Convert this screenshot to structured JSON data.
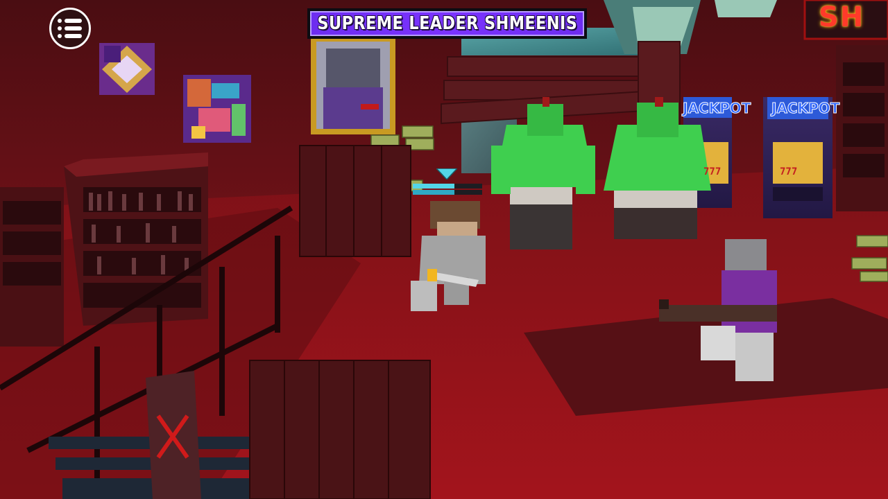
{
  "hud": {
    "menu_icon": "hamburger-menu-icon",
    "boss_name": "SUPREME LEADER SHMEENIS"
  },
  "player": {
    "health_fraction": 0.6,
    "stamina_fraction": 0.6,
    "marker_icon": "player-triangle-marker"
  },
  "scene": {
    "neon_sign_text": "SH",
    "slot_machines": [
      {
        "title": "JACKPOT",
        "reels": "777"
      },
      {
        "title": "JACKPOT",
        "reels": "777"
      }
    ]
  },
  "colors": {
    "banner_purple": "#7b33ff",
    "health_cyan": "#53d6e8",
    "floor_red": "#8e1219",
    "hulk_green": "#3fcf4f"
  }
}
